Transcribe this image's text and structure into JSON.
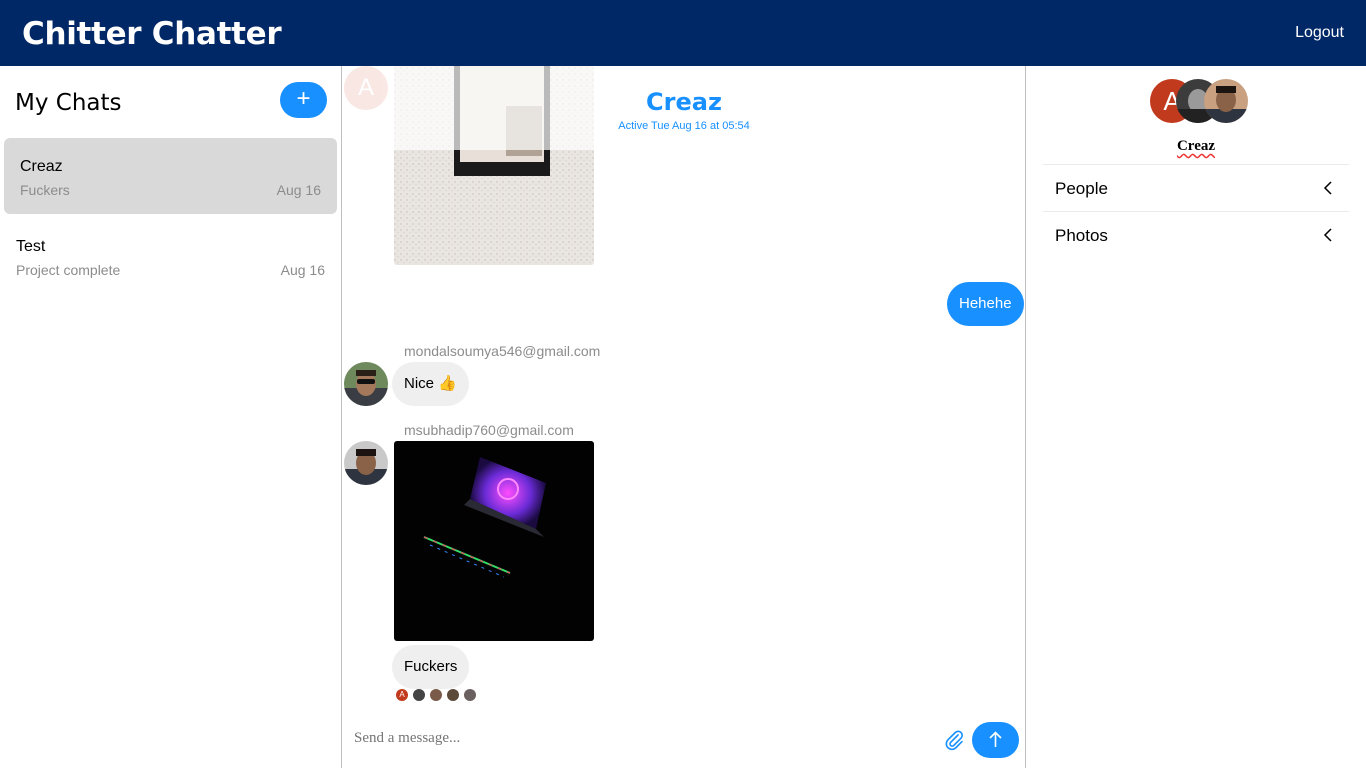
{
  "app": {
    "title": "Chitter Chatter",
    "logout_label": "Logout"
  },
  "sidebar": {
    "title": "My Chats",
    "new_chat_label": "+",
    "chats": [
      {
        "name": "Creaz",
        "preview": "Fuckers",
        "date": "Aug 16",
        "active": true
      },
      {
        "name": "Test",
        "preview": "Project complete",
        "date": "Aug 16",
        "active": false
      }
    ]
  },
  "chat": {
    "name": "Creaz",
    "active_status": "Active Tue Aug 16 at 05:54",
    "messages": [
      {
        "type": "image",
        "direction": "in",
        "description": "wall-photo"
      },
      {
        "type": "text",
        "direction": "out",
        "text": "Hehehe"
      },
      {
        "type": "text",
        "direction": "in",
        "sender": "mondalsoumya546@gmail.com",
        "text": "Nice 👍"
      },
      {
        "type": "image",
        "direction": "in",
        "sender": "msubhadip760@gmail.com",
        "description": "laptop-photo"
      },
      {
        "type": "text",
        "direction": "in",
        "text": "Fuckers"
      }
    ],
    "composer_placeholder": "Send a message...",
    "colors": {
      "accent": "#1890ff",
      "header_bg": "#002766",
      "incoming_bubble": "#efefef"
    }
  },
  "details": {
    "group_name": "Creaz",
    "avatar_letter": "A",
    "menu": [
      {
        "label": "People"
      },
      {
        "label": "Photos"
      }
    ]
  }
}
